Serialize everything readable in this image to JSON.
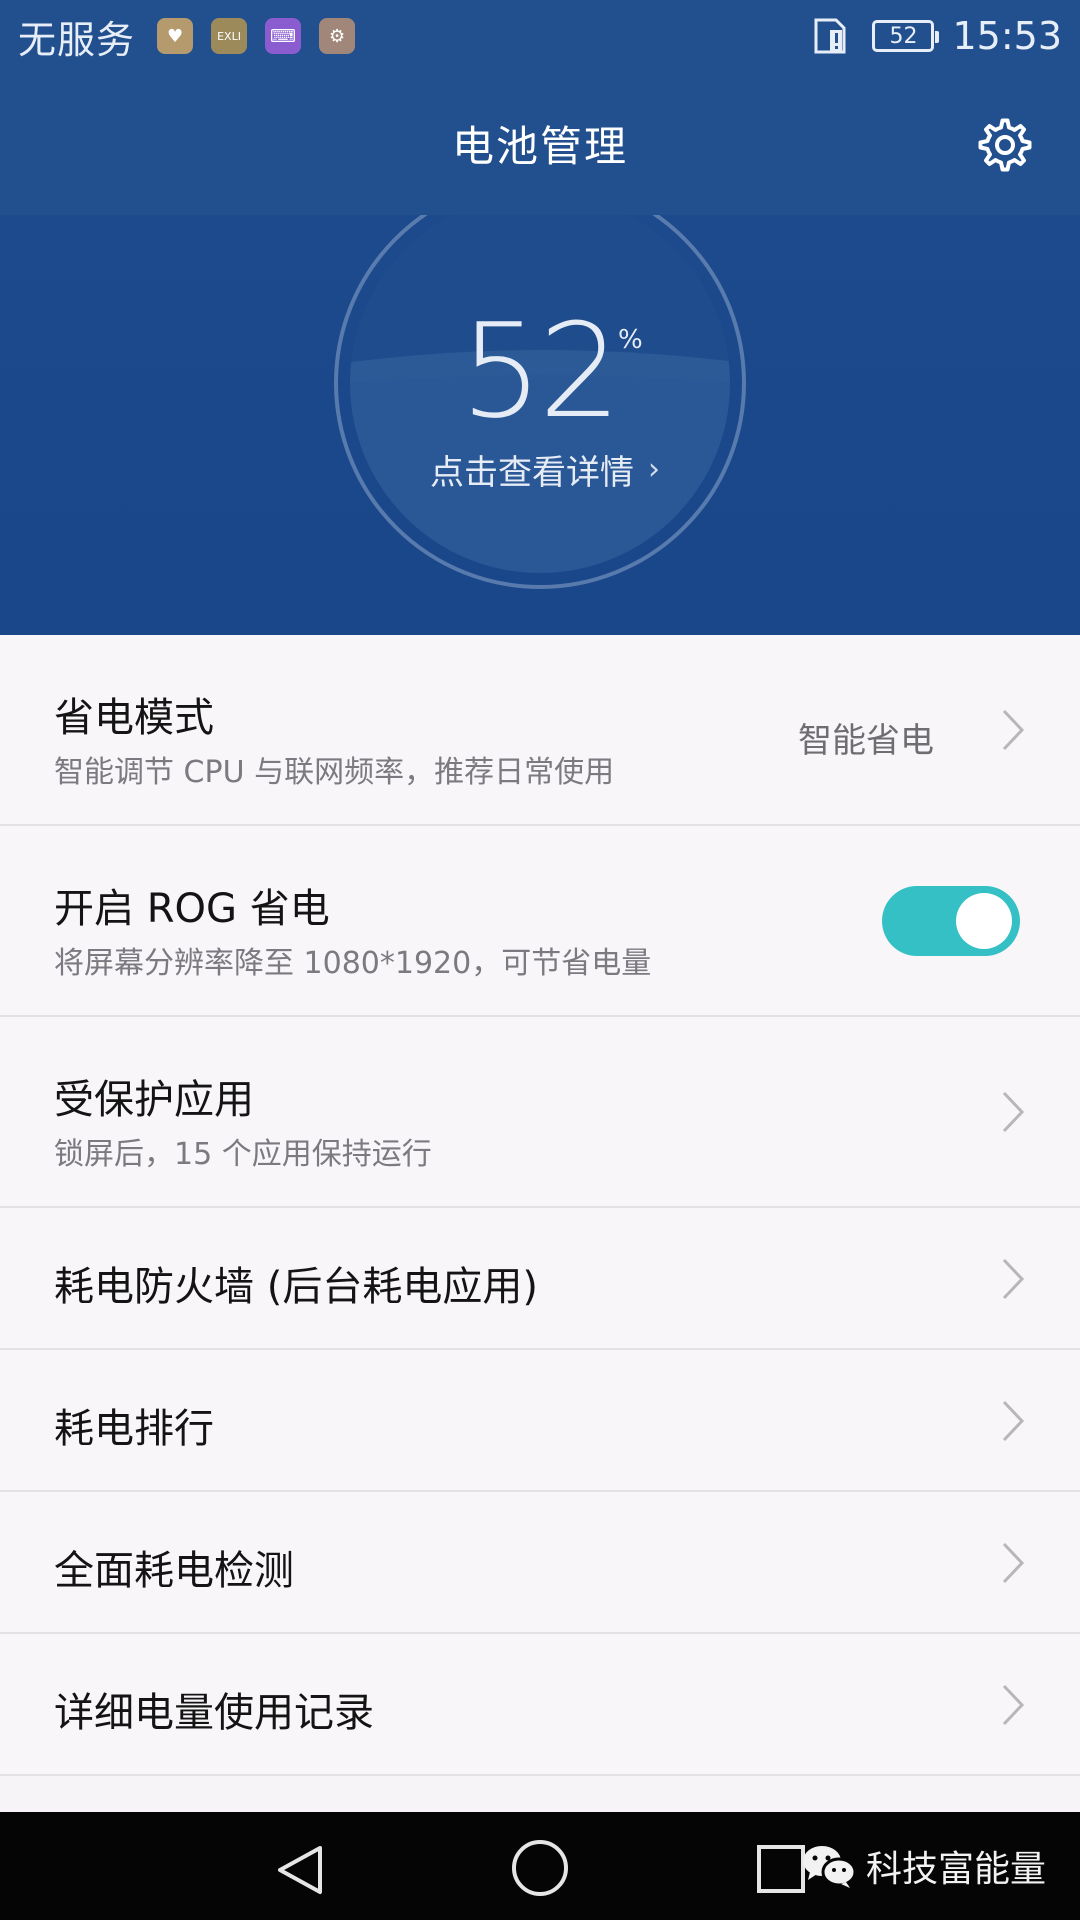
{
  "status_bar": {
    "carrier": "无服务",
    "app_icons": [
      {
        "icon": "health-app-icon",
        "color": "#b59a6e",
        "glyph": "♥"
      },
      {
        "icon": "exli-app-icon",
        "color": "#9c8a5a",
        "glyph": "EXLI"
      },
      {
        "icon": "keyboard-app-icon",
        "color": "#8a5ccf",
        "glyph": "⌨"
      },
      {
        "icon": "tool-app-icon",
        "color": "#a0877a",
        "glyph": "⚙"
      }
    ],
    "battery_level": "52",
    "time": "15:53"
  },
  "app_bar": {
    "title": "电池管理",
    "settings_icon": "gear-icon"
  },
  "hero": {
    "percent": "52",
    "percent_sign": "%",
    "details_label": "点击查看详情",
    "details_chevron": "›",
    "battery_fraction": 0.52
  },
  "list": {
    "power_saving": {
      "title": "省电模式",
      "subtitle": "智能调节 CPU 与联网频率，推荐日常使用",
      "value": "智能省电"
    },
    "rog": {
      "title": "开启 ROG 省电",
      "subtitle": "将屏幕分辨率降至 1080*1920，可节省电量",
      "toggle_on": true
    },
    "protected_apps": {
      "title": "受保护应用",
      "subtitle": "锁屏后，15 个应用保持运行"
    },
    "firewall": {
      "title": "耗电防火墙 (后台耗电应用)"
    },
    "ranking": {
      "title": "耗电排行"
    },
    "full_check": {
      "title": "全面耗电检测"
    },
    "usage_log": {
      "title": "详细电量使用记录"
    }
  },
  "nav_bar": {
    "watermark": "科技富能量"
  },
  "colors": {
    "primary": "#22508f",
    "toggle_on": "#34c0c4"
  }
}
